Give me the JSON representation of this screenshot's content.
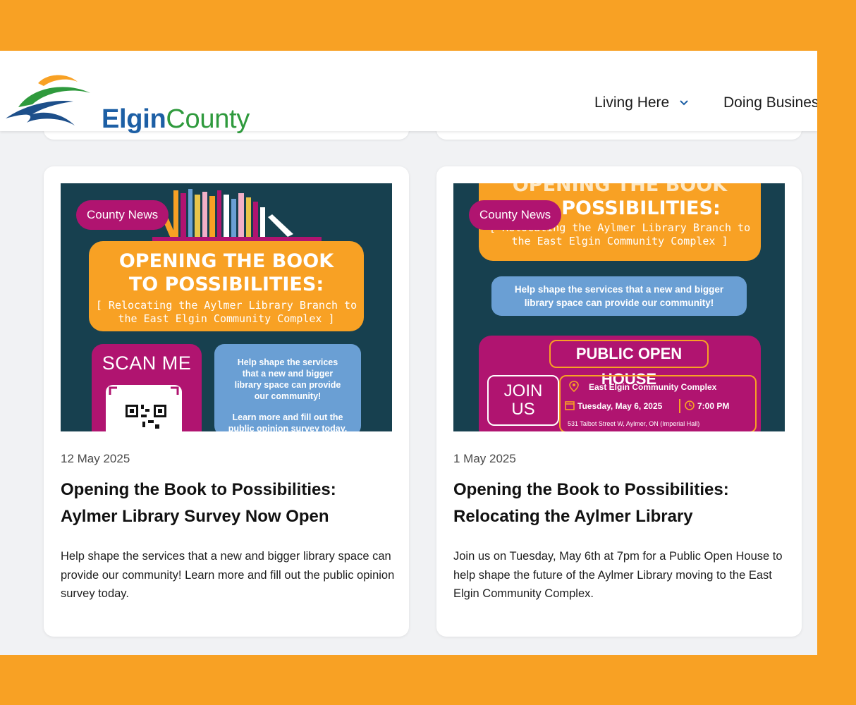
{
  "brand": {
    "name_bold": "Elgin",
    "name_regular": "County"
  },
  "nav": {
    "living_here": "Living Here",
    "doing_business": "Doing Busines"
  },
  "colors": {
    "frame": "#f8a124",
    "accent_magenta": "#b01470",
    "poster_bg": "#17404f",
    "poster_blue": "#6a9fd4",
    "brand_blue": "#1d5fa5",
    "brand_green": "#2f9a3d"
  },
  "cards": [
    {
      "tag": "County News",
      "poster": {
        "heading_1": "OPENING THE BOOK",
        "heading_2": "TO POSSIBILITIES:",
        "sub_1": "[ Relocating the Aylmer Library Branch to",
        "sub_2": "the East Elgin Community Complex ]",
        "scan": "SCAN ME",
        "blue_1": "Help shape the services",
        "blue_2": "that a new and bigger",
        "blue_3": "library space can provide",
        "blue_4": "our community!",
        "blue_5": "Learn more and fill out the",
        "blue_6": "public opinion survey today."
      },
      "date": "12 May 2025",
      "title": "Opening the Book to Possibilities: Aylmer Library Survey Now Open",
      "description": "Help shape the services that a new and bigger library space can provide our community! Learn more and fill out the public opinion survey today."
    },
    {
      "tag": "County News",
      "poster": {
        "heading_1": "OPENING THE BOOK",
        "heading_2": "POSSIBILITIES:",
        "sub_1": "[ Relocating the Aylmer Library Branch to",
        "sub_2": "the East Elgin Community Complex ]",
        "blue_1": "Help shape the services that a new and bigger",
        "blue_2": "library space can provide our community!",
        "open_house": "PUBLIC OPEN HOUSE",
        "join_1": "JOIN",
        "join_2": "US",
        "venue": "East Elgin Community Complex",
        "date": "Tuesday, May 6, 2025",
        "time": "7:00 PM",
        "address": "531 Talbot Street W, Aylmer, ON (Imperial Hall)"
      },
      "date": "1 May 2025",
      "title": "Opening the Book to Possibilities: Relocating the Aylmer Library",
      "description": "Join us on Tuesday, May 6th at 7pm for a Public Open House to help shape the future of the Aylmer Library moving to the East Elgin Community Complex."
    }
  ]
}
